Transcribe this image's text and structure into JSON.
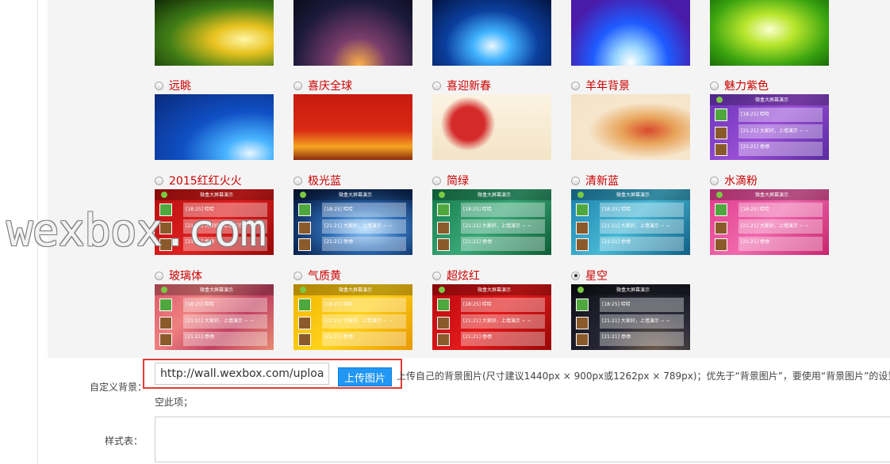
{
  "watermark": "wexbox.com",
  "background_options": [
    {
      "id": "yuantiao",
      "label": "远眺",
      "selected": false
    },
    {
      "id": "xiqingquanqiu",
      "label": "喜庆全球",
      "selected": false
    },
    {
      "id": "xiyingxinchun",
      "label": "喜迎新春",
      "selected": false
    },
    {
      "id": "yangnianbeijing",
      "label": "羊年背景",
      "selected": false
    },
    {
      "id": "meilizise",
      "label": "魅力紫色",
      "selected": false
    },
    {
      "id": "honghonghuohuo",
      "label": "2015红红火火",
      "selected": false
    },
    {
      "id": "jiguanglan",
      "label": "极光蓝",
      "selected": false
    },
    {
      "id": "jianlv",
      "label": "简绿",
      "selected": false
    },
    {
      "id": "qingxinlan",
      "label": "清新蓝",
      "selected": false
    },
    {
      "id": "shuidifen",
      "label": "水滴粉",
      "selected": false
    },
    {
      "id": "bolidi",
      "label": "玻璃体",
      "selected": false
    },
    {
      "id": "qizhihuang",
      "label": "气质黄",
      "selected": false
    },
    {
      "id": "chaoxuanhong",
      "label": "超炫红",
      "selected": false
    },
    {
      "id": "xingkong",
      "label": "星空",
      "selected": true
    }
  ],
  "wall_mock": {
    "title": "微盒大屏幕演示",
    "msg1": "[18:25] 哈哈",
    "msg2": "[21:21] 大家好，上墙演示 ~ ~",
    "msg3": "[21:21] 😎😎"
  },
  "custom_bg": {
    "label": "自定义背景：",
    "url_value": "http://wall.wexbox.com/uploads/",
    "upload_label": "上传图片",
    "hint": "上传自己的背景图片(尺寸建议1440px × 900px或1262px × 789px)；优先于“背景图片”，要使用“背景图片”的设置请",
    "hint_cont": "空此项；"
  },
  "stylesheet": {
    "label": "样式表："
  },
  "colors": {
    "accent_red": "#cc0000",
    "button_blue": "#2196f3",
    "highlight_red": "#e53935"
  }
}
